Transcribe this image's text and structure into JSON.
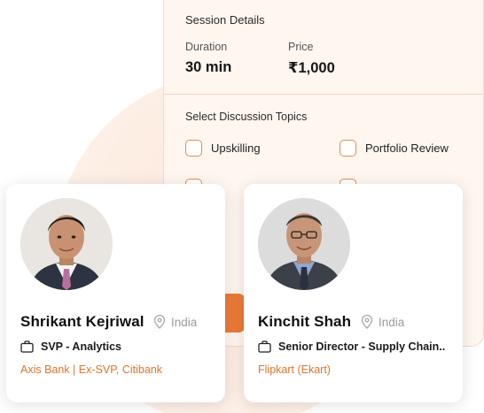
{
  "session": {
    "title": "Session Details",
    "duration_label": "Duration",
    "duration_value": "30 min",
    "price_label": "Price",
    "price_value": "₹1,000",
    "topics_title": "Select Discussion Topics",
    "topics": [
      "Upskilling",
      "Portfolio Review"
    ]
  },
  "mentors": [
    {
      "name": "Shrikant Kejriwal",
      "location": "India",
      "role": "SVP - Analytics",
      "company": "Axis Bank | Ex-SVP, Citibank"
    },
    {
      "name": "Kinchit Shah",
      "location": "India",
      "role": "Senior Director - Supply Chain..",
      "company": "Flipkart (Ekart)"
    }
  ],
  "colors": {
    "accent": "#ec7a37",
    "accent_text": "#e0742d",
    "panel_bg": "#fff6ef"
  }
}
